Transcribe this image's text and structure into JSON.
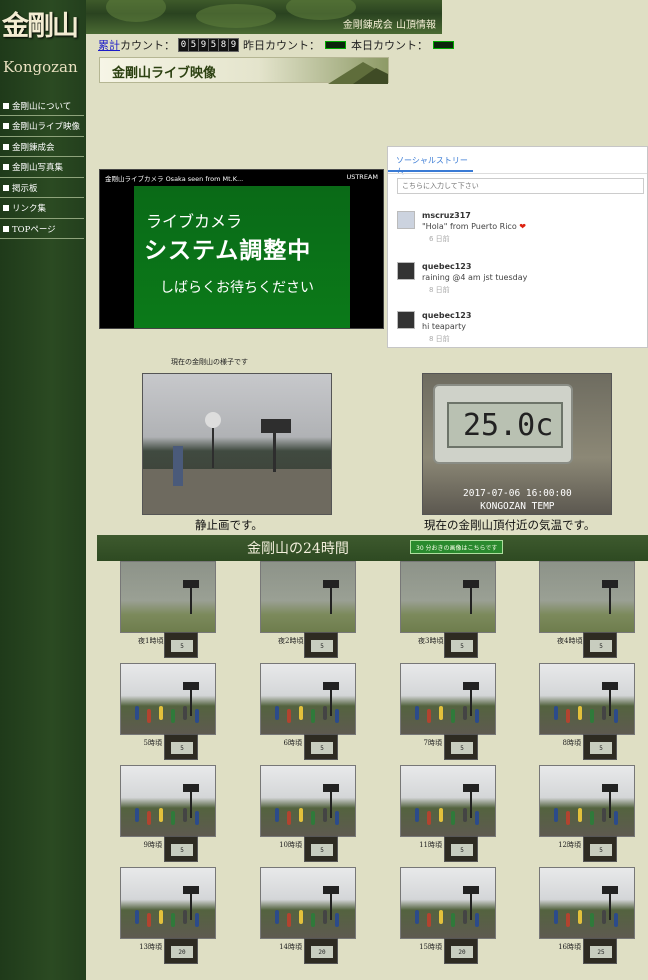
{
  "logo": {
    "kanji": "金剛山",
    "roman": "Kongozan"
  },
  "nav": [
    "金剛山について",
    "金剛山ライブ映像",
    "金剛錬成会",
    "金剛山写真集",
    "掲示板",
    "リンク集",
    "TOPページ"
  ],
  "header": {
    "subtitle": "金剛錬成会 山頂情報",
    "cumulative_link": "累計",
    "count_label": "カウント：",
    "cumulative_digits": [
      "0",
      "5",
      "9",
      "5",
      "8",
      "9"
    ],
    "yesterday_label": "昨日カウント：",
    "today_label": "本日カウント："
  },
  "section_title": "金剛山ライブ映像",
  "stream": {
    "title_bar": "金剛山ライブカメラ Osaka seen from Mt.K...",
    "brand": "USTREAM",
    "line1": "ライブカメラ",
    "line2": "システム調整中",
    "line3": "しばらくお待ちください"
  },
  "social": {
    "tab": "ソーシャルストリーム",
    "placeholder": "こちらに入力して下さい",
    "posts": [
      {
        "user": "mscruz317",
        "message": "\"Hola\" from Puerto Rico",
        "heart": "❤",
        "ago": "6 日前"
      },
      {
        "user": "quebec123",
        "message": "raining @4 am jst tuesday",
        "ago": "8 日前"
      },
      {
        "user": "quebec123",
        "message": "hi teaparty",
        "ago": "8 日前"
      }
    ]
  },
  "now": {
    "caption": "現在の金剛山の様子です",
    "still_caption": "静止画です。",
    "temp_reading": "25.0c",
    "temp_stamp_date": "2017-07-06 16:00:00",
    "temp_stamp_name": "KONGOZAN TEMP",
    "temp_caption": "現在の金剛山頂付近の気温です。"
  },
  "hours24": {
    "title": "金剛山の24時間",
    "button": "30 分おきの画像はこちらです",
    "cells": [
      {
        "label": "夜1時頃",
        "temp": "5",
        "scene": "night"
      },
      {
        "label": "夜2時頃",
        "temp": "5",
        "scene": "night"
      },
      {
        "label": "夜3時頃",
        "temp": "5",
        "scene": "night"
      },
      {
        "label": "夜4時頃",
        "temp": "5",
        "scene": "night"
      },
      {
        "label": "5時頃",
        "temp": "5",
        "scene": "day"
      },
      {
        "label": "6時頃",
        "temp": "5",
        "scene": "day"
      },
      {
        "label": "7時頃",
        "temp": "5",
        "scene": "day"
      },
      {
        "label": "8時頃",
        "temp": "5",
        "scene": "day"
      },
      {
        "label": "9時頃",
        "temp": "5",
        "scene": "day"
      },
      {
        "label": "10時頃",
        "temp": "5",
        "scene": "day"
      },
      {
        "label": "11時頃",
        "temp": "5",
        "scene": "day"
      },
      {
        "label": "12時頃",
        "temp": "5",
        "scene": "day"
      },
      {
        "label": "13時頃",
        "temp": "20",
        "scene": "day"
      },
      {
        "label": "14時頃",
        "temp": "20",
        "scene": "day"
      },
      {
        "label": "15時頃",
        "temp": "20",
        "scene": "day"
      },
      {
        "label": "16時頃",
        "temp": "25",
        "scene": "day"
      }
    ]
  }
}
